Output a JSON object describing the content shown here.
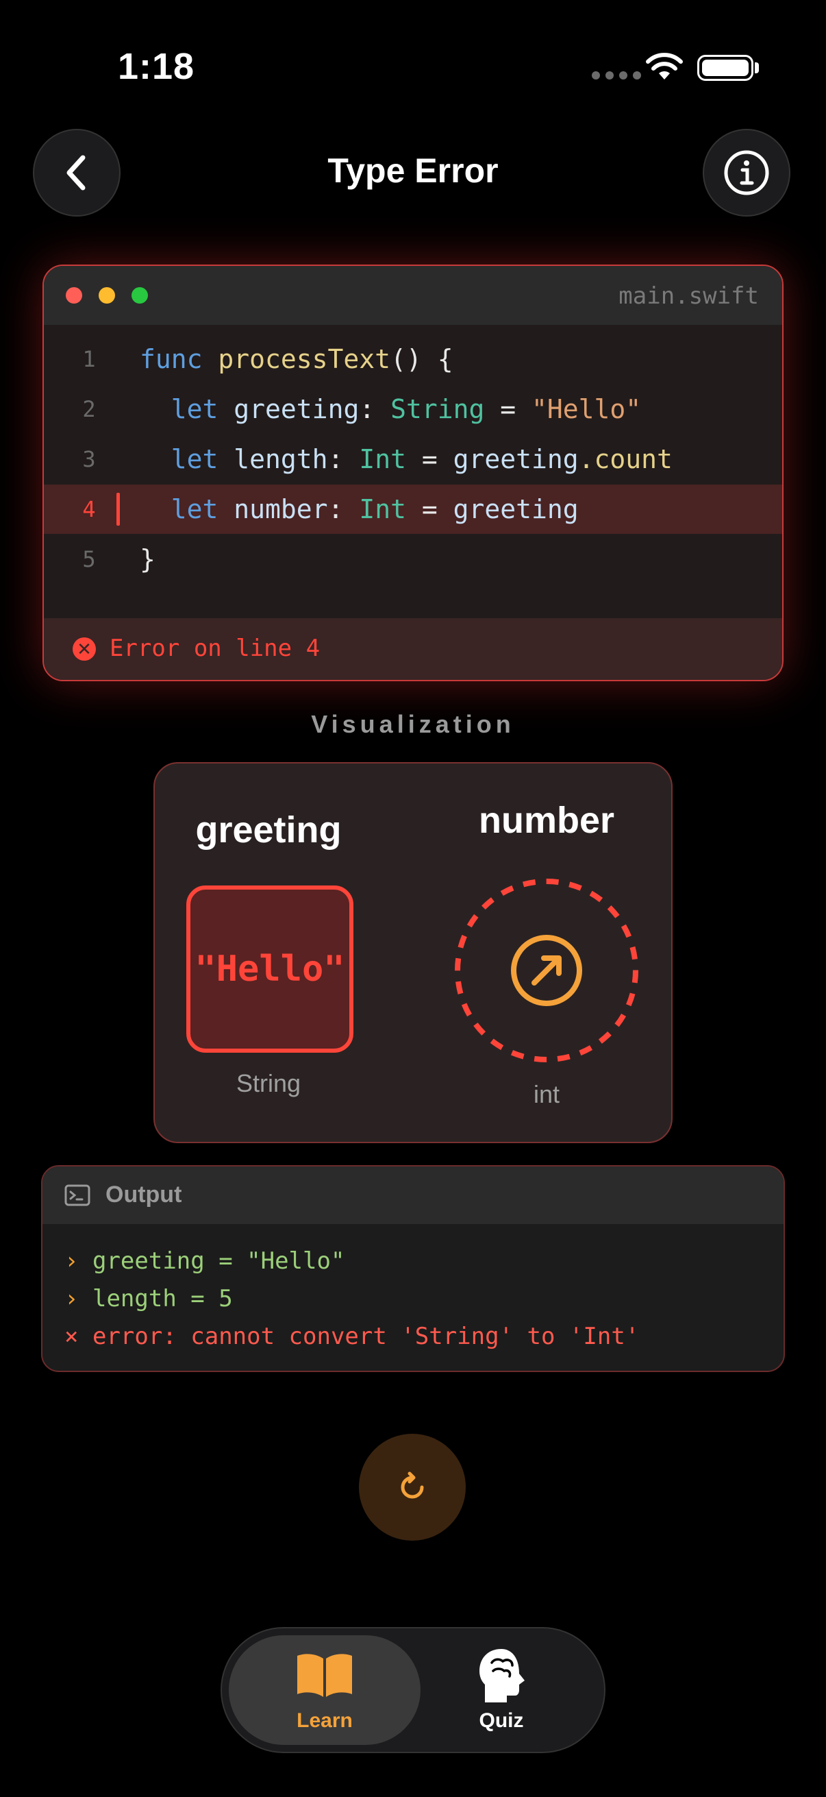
{
  "status": {
    "time": "1:18"
  },
  "header": {
    "title": "Type Error"
  },
  "editor": {
    "filename": "main.swift",
    "error_line": 4,
    "lines": [
      {
        "num": "1",
        "tokens": [
          [
            "kw",
            "func"
          ],
          [
            "pl",
            " "
          ],
          [
            "fn",
            "processText"
          ],
          [
            "pl",
            "() {"
          ]
        ]
      },
      {
        "num": "2",
        "tokens": [
          [
            "pl",
            "  "
          ],
          [
            "kw",
            "let"
          ],
          [
            "pl",
            " "
          ],
          [
            "id",
            "greeting"
          ],
          [
            "pl",
            ": "
          ],
          [
            "ty",
            "String"
          ],
          [
            "pl",
            " = "
          ],
          [
            "st",
            "\"Hello\""
          ]
        ]
      },
      {
        "num": "3",
        "tokens": [
          [
            "pl",
            "  "
          ],
          [
            "kw",
            "let"
          ],
          [
            "pl",
            " "
          ],
          [
            "id",
            "length"
          ],
          [
            "pl",
            ": "
          ],
          [
            "ty",
            "Int"
          ],
          [
            "pl",
            " = "
          ],
          [
            "id",
            "greeting"
          ],
          [
            "fn",
            ".count"
          ]
        ]
      },
      {
        "num": "4",
        "tokens": [
          [
            "pl",
            "  "
          ],
          [
            "kw",
            "let"
          ],
          [
            "pl",
            " "
          ],
          [
            "id",
            "number"
          ],
          [
            "pl",
            ": "
          ],
          [
            "ty",
            "Int"
          ],
          [
            "pl",
            " = "
          ],
          [
            "id",
            "greeting"
          ]
        ]
      },
      {
        "num": "5",
        "tokens": [
          [
            "pl",
            "}"
          ]
        ]
      }
    ],
    "error_message": "Error on line 4"
  },
  "visualization": {
    "title": "Visualization",
    "left": {
      "name": "greeting",
      "value": "\"Hello\"",
      "type": "String"
    },
    "right": {
      "name": "number",
      "type": "int"
    }
  },
  "output": {
    "title": "Output",
    "lines": [
      {
        "prefix": "›",
        "text": "greeting = \"Hello\"",
        "kind": "ok"
      },
      {
        "prefix": "›",
        "text": "length = 5",
        "kind": "ok"
      },
      {
        "prefix": "×",
        "text": "error: cannot convert 'String' to 'Int'",
        "kind": "bad"
      }
    ]
  },
  "tabs": [
    {
      "label": "Learn",
      "icon": "book-icon",
      "active": true
    },
    {
      "label": "Quiz",
      "icon": "brain-head-icon",
      "active": false
    }
  ],
  "colors": {
    "accent": "#F5A23A",
    "error": "#FF453A",
    "background": "#000000"
  }
}
